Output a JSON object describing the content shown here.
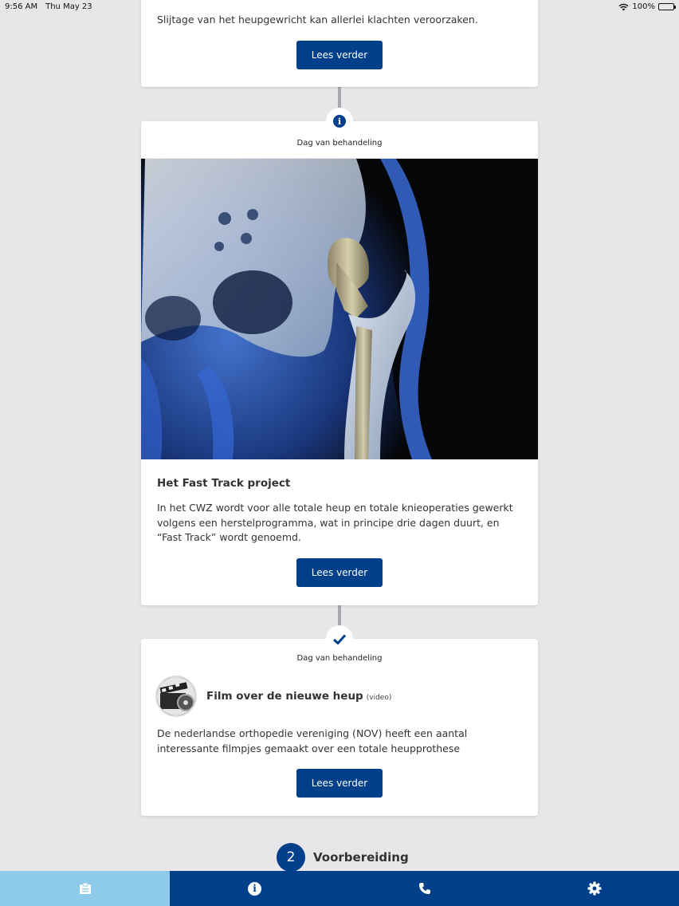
{
  "status_bar": {
    "time": "9:56 AM",
    "date": "Thu May 23",
    "battery": "100%"
  },
  "cards": {
    "top": {
      "text": "Slijtage van het heupgewricht kan allerlei klachten veroorzaken.",
      "button": "Lees verder"
    },
    "fast_track": {
      "node_icon": "info-icon",
      "header": "Dag van behandeling",
      "image": "hip-xray-image",
      "title": "Het Fast Track project",
      "text": "In het CWZ wordt voor alle totale heup en totale knieoperaties gewerkt volgens een herstelprogramma, wat in principe drie dagen duurt, en “Fast Track” wordt genoemd.",
      "button": "Lees verder"
    },
    "film": {
      "node_icon": "checkmark-icon",
      "header": "Dag van behandeling",
      "title": "Film over de nieuwe heup",
      "tag": "(video)",
      "text": "De nederlandse orthopedie vereniging (NOV) heeft een aantal interessante filmpjes gemaakt over een totale heupprothese",
      "button": "Lees verder"
    }
  },
  "section": {
    "number": "2",
    "label": "Voorbereiding"
  },
  "tabbar": {
    "tabs": [
      {
        "icon": "clipboard-icon",
        "active": true
      },
      {
        "icon": "info-icon",
        "active": false
      },
      {
        "icon": "phone-icon",
        "active": false
      },
      {
        "icon": "gear-icon",
        "active": false
      }
    ]
  },
  "colors": {
    "primary": "#003f8a",
    "active_tab": "#8ecbea",
    "background": "#e8e6e8"
  }
}
